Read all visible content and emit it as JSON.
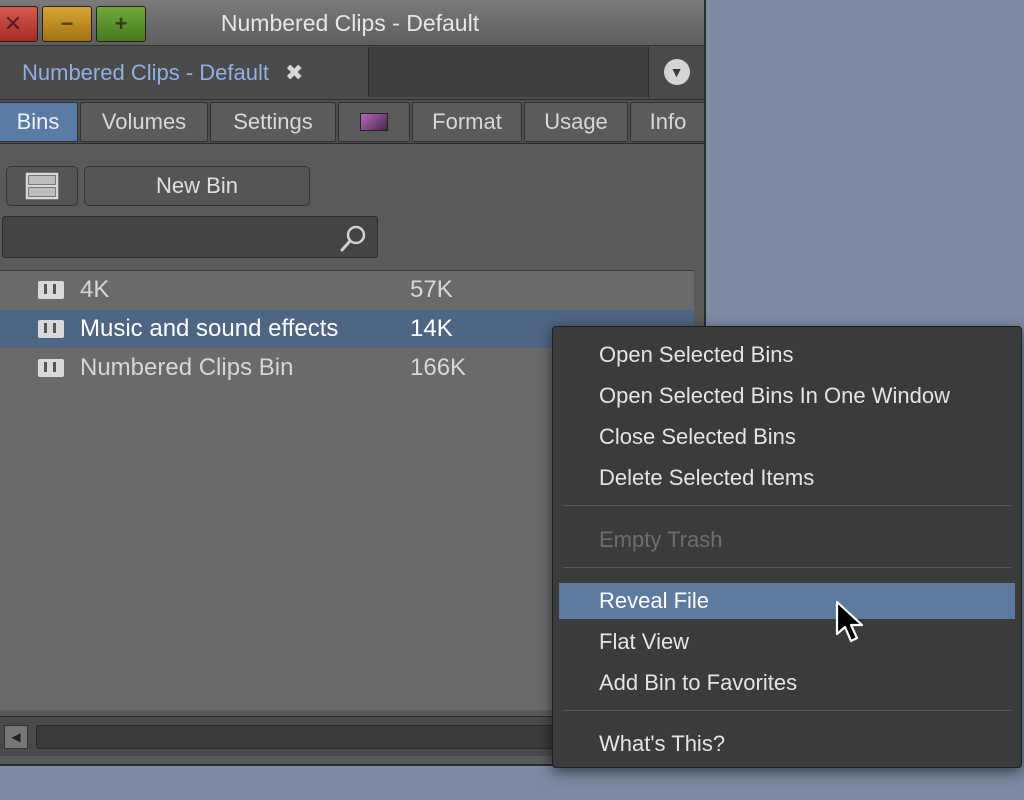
{
  "window": {
    "title": "Numbered Clips - Default",
    "close_glyph": "✕",
    "min_glyph": "−",
    "max_glyph": "+"
  },
  "doc_tab": {
    "label": "Numbered Clips - Default",
    "close_glyph": "✖",
    "dropdown_glyph": "▼"
  },
  "tabs": [
    {
      "label": "Bins",
      "active": true
    },
    {
      "label": "Volumes"
    },
    {
      "label": "Settings"
    },
    {
      "label": "",
      "icon": "color-swatch-icon"
    },
    {
      "label": "Format"
    },
    {
      "label": "Usage"
    },
    {
      "label": "Info"
    }
  ],
  "toolbar": {
    "new_bin_label": "New Bin"
  },
  "search": {
    "value": "",
    "placeholder": ""
  },
  "bins": [
    {
      "name": "4K",
      "size": "57K",
      "selected": false
    },
    {
      "name": "Music and sound effects",
      "size": "14K",
      "selected": true
    },
    {
      "name": "Numbered Clips Bin",
      "size": "166K",
      "selected": false
    }
  ],
  "context_menu": {
    "items": [
      {
        "label": "Open Selected Bins"
      },
      {
        "label": "Open Selected Bins In One Window"
      },
      {
        "label": "Close Selected Bins"
      },
      {
        "label": "Delete Selected Items"
      },
      {
        "label": "Empty Trash",
        "disabled": true
      },
      {
        "label": "Reveal File",
        "highlighted": true
      },
      {
        "label": "Flat View"
      },
      {
        "label": "Add Bin to Favorites"
      },
      {
        "label": "What's This?"
      }
    ]
  },
  "colors": {
    "accent": "#5a7ba4",
    "selection": "#4f6584",
    "menu_highlight": "#5d7ba0",
    "desktop": "#7c8aa3"
  }
}
